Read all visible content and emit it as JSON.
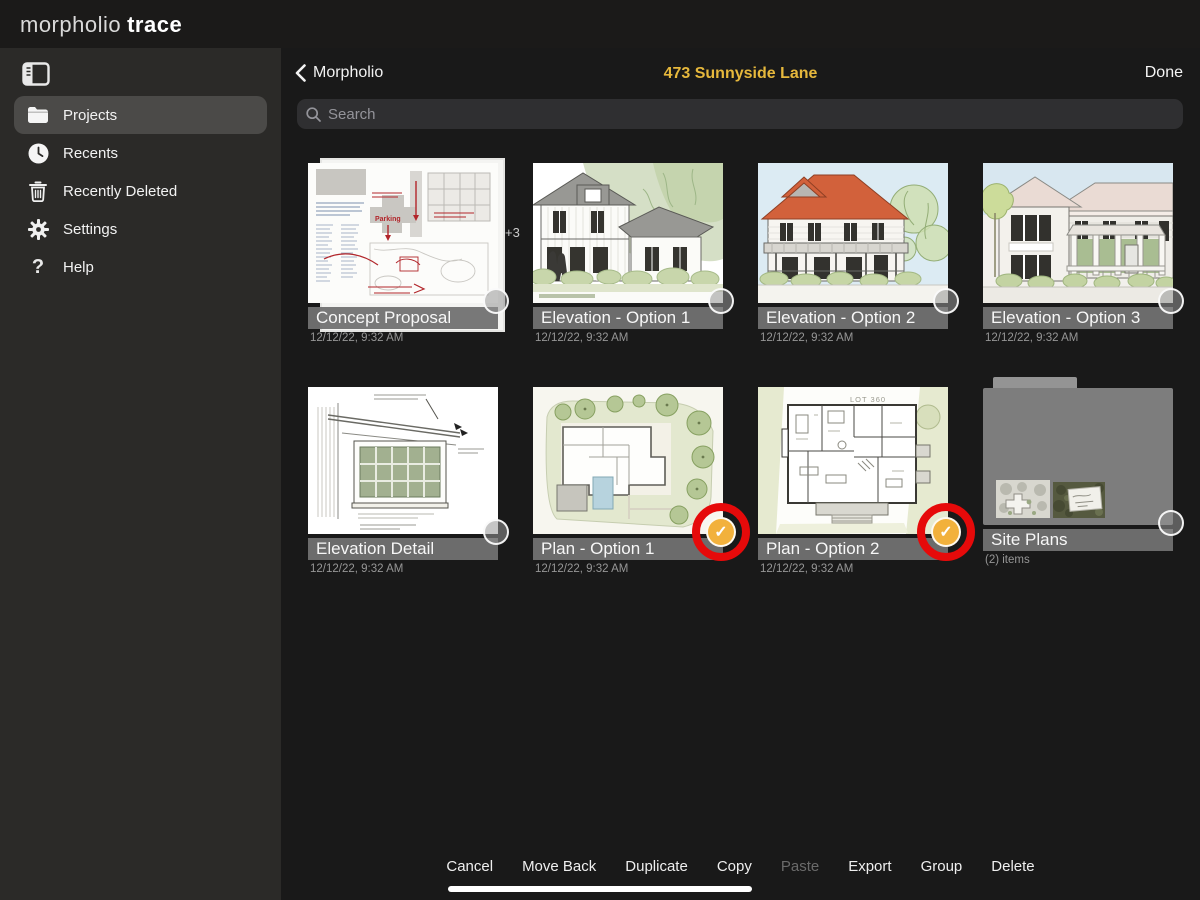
{
  "app": {
    "brand_primary": "morpholio",
    "brand_secondary": "trace"
  },
  "sidebar": {
    "items": [
      {
        "label": "Projects",
        "icon": "folder-icon",
        "selected": true
      },
      {
        "label": "Recents",
        "icon": "clock-icon",
        "selected": false
      },
      {
        "label": "Recently Deleted",
        "icon": "trash-icon",
        "selected": false
      },
      {
        "label": "Settings",
        "icon": "gear-icon",
        "selected": false
      },
      {
        "label": "Help",
        "icon": "question-icon",
        "selected": false
      }
    ]
  },
  "header": {
    "back_label": "Morpholio",
    "title": "473 Sunnyside Lane",
    "done_label": "Done"
  },
  "search": {
    "placeholder": "Search",
    "value": ""
  },
  "grid": {
    "items": [
      {
        "title": "Concept Proposal",
        "meta": "12/12/22, 9:32 AM",
        "selected": false,
        "type": "document-stack",
        "stack_badge": "+3"
      },
      {
        "title": "Elevation - Option 1",
        "meta": "12/12/22, 9:32 AM",
        "selected": false,
        "type": "document"
      },
      {
        "title": "Elevation - Option 2",
        "meta": "12/12/22, 9:32 AM",
        "selected": false,
        "type": "document"
      },
      {
        "title": "Elevation - Option 3",
        "meta": "12/12/22, 9:32 AM",
        "selected": false,
        "type": "document"
      },
      {
        "title": "Elevation Detail",
        "meta": "12/12/22, 9:32 AM",
        "selected": false,
        "type": "document"
      },
      {
        "title": "Plan - Option 1",
        "meta": "12/12/22, 9:32 AM",
        "selected": true,
        "type": "document",
        "annotated": true
      },
      {
        "title": "Plan - Option 2",
        "meta": "12/12/22, 9:32 AM",
        "selected": true,
        "type": "document",
        "annotated": true
      },
      {
        "title": "Site Plans",
        "meta": "(2) items",
        "selected": false,
        "type": "folder"
      }
    ]
  },
  "toolbar": {
    "actions": [
      {
        "label": "Cancel",
        "enabled": true
      },
      {
        "label": "Move Back",
        "enabled": true
      },
      {
        "label": "Duplicate",
        "enabled": true
      },
      {
        "label": "Copy",
        "enabled": true
      },
      {
        "label": "Paste",
        "enabled": false
      },
      {
        "label": "Export",
        "enabled": true
      },
      {
        "label": "Group",
        "enabled": true
      },
      {
        "label": "Delete",
        "enabled": true
      }
    ]
  },
  "colors": {
    "title_accent": "#e6b83c",
    "selection_check": "#f2b13c",
    "annotation_ring": "#e60a0a",
    "sidebar_bg": "#2b2a28",
    "main_bg": "#191919"
  }
}
